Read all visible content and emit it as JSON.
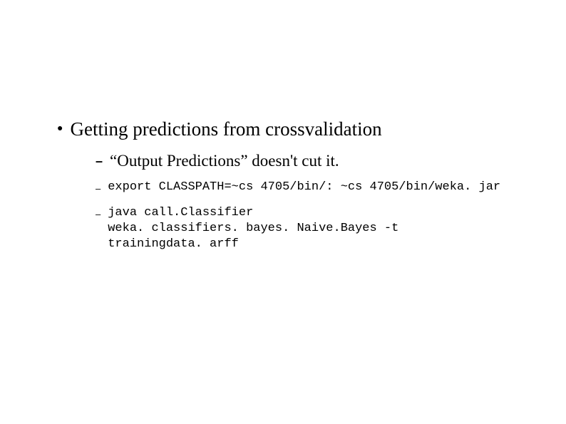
{
  "slide": {
    "bullet": {
      "text": "Getting predictions from crossvalidation",
      "subs": [
        {
          "text": "“Output Predictions” doesn't cut it.",
          "mono": false
        },
        {
          "text": "export CLASSPATH=~cs 4705/bin/: ~cs 4705/bin/weka. jar",
          "mono": true
        },
        {
          "text": "java call.Classifier\nweka. classifiers. bayes. Naive.Bayes -t\ntrainingdata. arff",
          "mono": true
        }
      ]
    }
  }
}
